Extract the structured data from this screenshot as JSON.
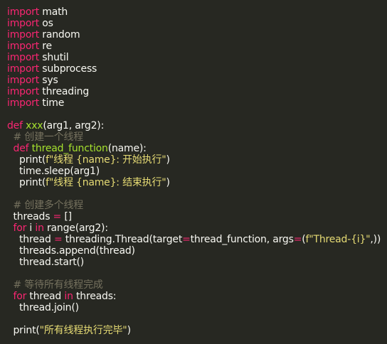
{
  "theme": {
    "background": "#272822",
    "plain": "#f8f8f2",
    "keyword": "#f92672",
    "function": "#a6e22e",
    "string": "#e6db74",
    "comment": "#75715e"
  },
  "code_lines": [
    [
      {
        "t": "import",
        "c": "kw"
      },
      {
        "t": " math",
        "c": "pl"
      }
    ],
    [
      {
        "t": "import",
        "c": "kw"
      },
      {
        "t": " os",
        "c": "pl"
      }
    ],
    [
      {
        "t": "import",
        "c": "kw"
      },
      {
        "t": " random",
        "c": "pl"
      }
    ],
    [
      {
        "t": "import",
        "c": "kw"
      },
      {
        "t": " re",
        "c": "pl"
      }
    ],
    [
      {
        "t": "import",
        "c": "kw"
      },
      {
        "t": " shutil",
        "c": "pl"
      }
    ],
    [
      {
        "t": "import",
        "c": "kw"
      },
      {
        "t": " subprocess",
        "c": "pl"
      }
    ],
    [
      {
        "t": "import",
        "c": "kw"
      },
      {
        "t": " sys",
        "c": "pl"
      }
    ],
    [
      {
        "t": "import",
        "c": "kw"
      },
      {
        "t": " threading",
        "c": "pl"
      }
    ],
    [
      {
        "t": "import",
        "c": "kw"
      },
      {
        "t": " time",
        "c": "pl"
      }
    ],
    [],
    [
      {
        "t": "def",
        "c": "kw"
      },
      {
        "t": " ",
        "c": "pl"
      },
      {
        "t": "xxx",
        "c": "fn"
      },
      {
        "t": "(arg1, arg2):",
        "c": "pl"
      }
    ],
    [
      {
        "t": "  ",
        "c": "pl"
      },
      {
        "t": "# 创建一个线程",
        "c": "cm"
      }
    ],
    [
      {
        "t": "  ",
        "c": "pl"
      },
      {
        "t": "def",
        "c": "kw"
      },
      {
        "t": " ",
        "c": "pl"
      },
      {
        "t": "thread_function",
        "c": "fn"
      },
      {
        "t": "(name):",
        "c": "pl"
      }
    ],
    [
      {
        "t": "    print(",
        "c": "pl"
      },
      {
        "t": "f\"线程 {name}: 开始执行\"",
        "c": "str"
      },
      {
        "t": ")",
        "c": "pl"
      }
    ],
    [
      {
        "t": "    time.sleep(arg1)",
        "c": "pl"
      }
    ],
    [
      {
        "t": "    print(",
        "c": "pl"
      },
      {
        "t": "f\"线程 {name}: 结束执行\"",
        "c": "str"
      },
      {
        "t": ")",
        "c": "pl"
      }
    ],
    [],
    [
      {
        "t": "  ",
        "c": "pl"
      },
      {
        "t": "# 创建多个线程",
        "c": "cm"
      }
    ],
    [
      {
        "t": "  threads ",
        "c": "pl"
      },
      {
        "t": "=",
        "c": "kw"
      },
      {
        "t": " []",
        "c": "pl"
      }
    ],
    [
      {
        "t": "  ",
        "c": "pl"
      },
      {
        "t": "for",
        "c": "kw"
      },
      {
        "t": " i ",
        "c": "pl"
      },
      {
        "t": "in",
        "c": "kw"
      },
      {
        "t": " range(arg2):",
        "c": "pl"
      }
    ],
    [
      {
        "t": "    thread ",
        "c": "pl"
      },
      {
        "t": "=",
        "c": "kw"
      },
      {
        "t": " threading.Thread(target",
        "c": "pl"
      },
      {
        "t": "=",
        "c": "kw"
      },
      {
        "t": "thread_function, args",
        "c": "pl"
      },
      {
        "t": "=",
        "c": "kw"
      },
      {
        "t": "(",
        "c": "pl"
      },
      {
        "t": "f\"Thread-{i}\"",
        "c": "str"
      },
      {
        "t": ",))",
        "c": "pl"
      }
    ],
    [
      {
        "t": "    threads.append(thread)",
        "c": "pl"
      }
    ],
    [
      {
        "t": "    thread.start()",
        "c": "pl"
      }
    ],
    [],
    [
      {
        "t": "  ",
        "c": "pl"
      },
      {
        "t": "# 等待所有线程完成",
        "c": "cm"
      }
    ],
    [
      {
        "t": "  ",
        "c": "pl"
      },
      {
        "t": "for",
        "c": "kw"
      },
      {
        "t": " thread ",
        "c": "pl"
      },
      {
        "t": "in",
        "c": "kw"
      },
      {
        "t": " threads:",
        "c": "pl"
      }
    ],
    [
      {
        "t": "    thread.join()",
        "c": "pl"
      }
    ],
    [],
    [
      {
        "t": "  print(",
        "c": "pl"
      },
      {
        "t": "\"所有线程执行完毕\"",
        "c": "str"
      },
      {
        "t": ")",
        "c": "pl"
      }
    ]
  ]
}
